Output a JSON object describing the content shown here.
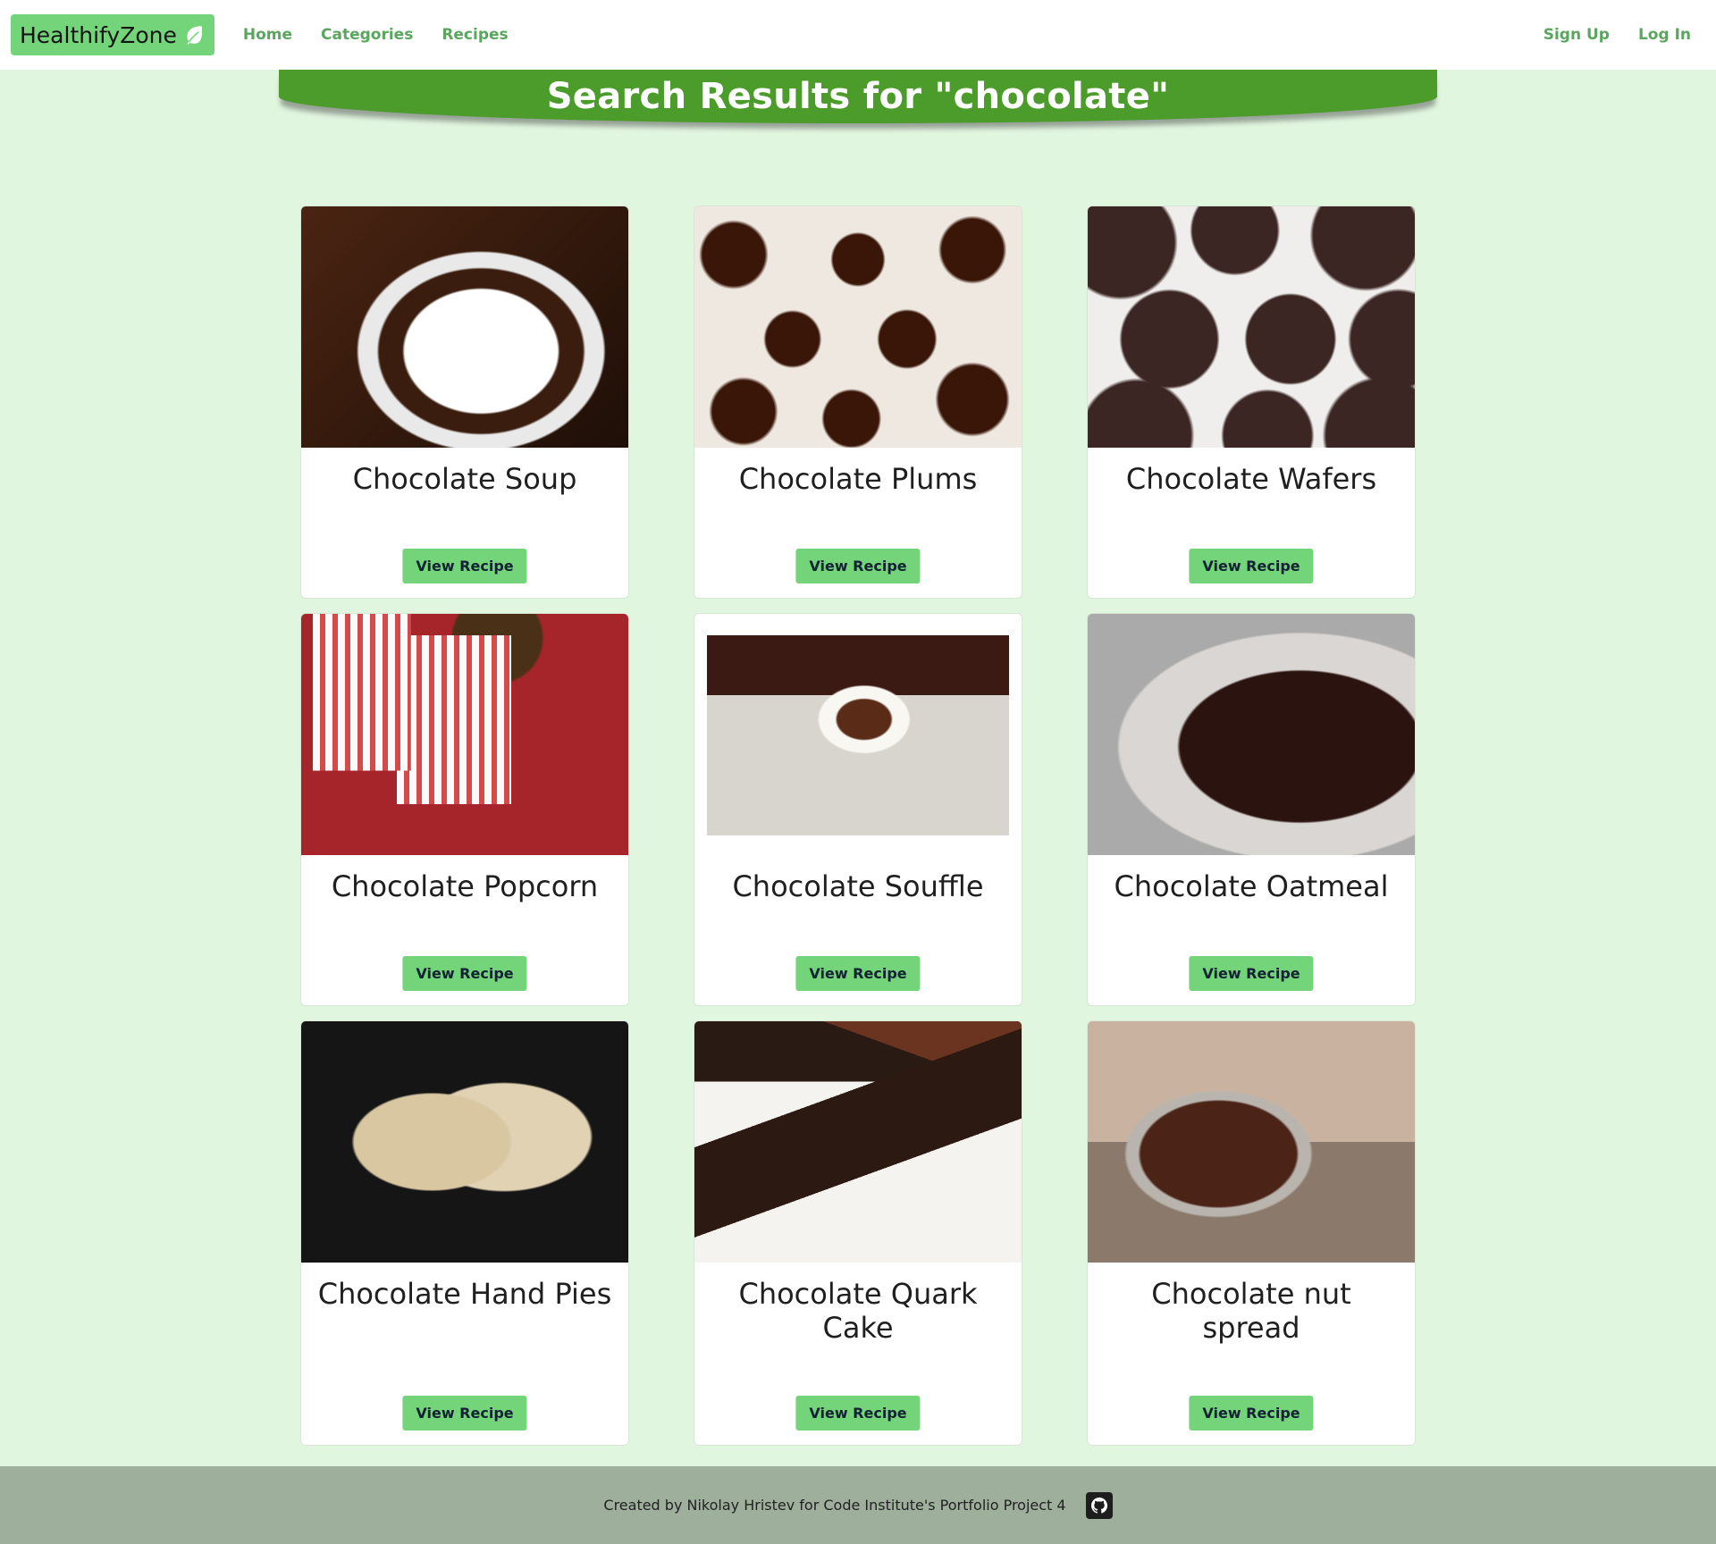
{
  "navbar": {
    "brand": "HealthifyZone",
    "brand_icon": "leaf-icon",
    "links": [
      "Home",
      "Categories",
      "Recipes"
    ],
    "right_links": [
      "Sign Up",
      "Log In"
    ]
  },
  "banner": {
    "title": "Search Results for \"chocolate\""
  },
  "recipes": [
    {
      "title": "Chocolate Soup",
      "button": "View Recipe"
    },
    {
      "title": "Chocolate Plums",
      "button": "View Recipe"
    },
    {
      "title": "Chocolate Wafers",
      "button": "View Recipe"
    },
    {
      "title": "Chocolate Popcorn",
      "button": "View Recipe"
    },
    {
      "title": "Chocolate Souffle",
      "button": "View Recipe"
    },
    {
      "title": "Chocolate Oatmeal",
      "button": "View Recipe"
    },
    {
      "title": "Chocolate Hand Pies",
      "button": "View Recipe"
    },
    {
      "title": "Chocolate Quark Cake",
      "button": "View Recipe"
    },
    {
      "title": "Chocolate nut spread",
      "button": "View Recipe"
    }
  ],
  "footer": {
    "text": "Created by Nikolay Hristev for Code Institute's Portfolio Project 4",
    "icon": "github-icon"
  },
  "colors": {
    "page_bg": "#e1f6df",
    "brand_bg": "#74d47a",
    "banner_bg": "#4b9c2b",
    "link": "#5aa65f",
    "footer_bg": "#9eaf9c"
  }
}
